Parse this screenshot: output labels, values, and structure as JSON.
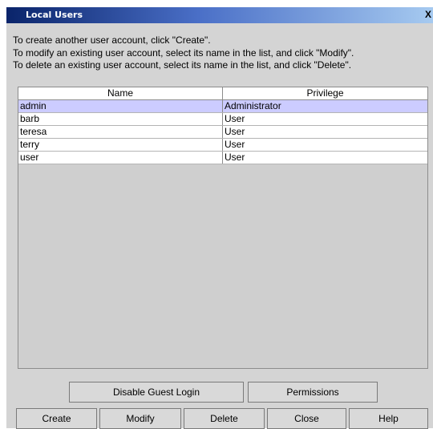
{
  "window": {
    "title": "Local Users",
    "close_glyph": "X"
  },
  "instructions": [
    "To create another user account, click \"Create\".",
    "To modify an existing user account, select its name in the list, and click \"Modify\".",
    "To delete an existing user account, select its name in the list, and click \"Delete\"."
  ],
  "table": {
    "headers": [
      "Name",
      "Privilege"
    ],
    "rows": [
      {
        "name": "admin",
        "privilege": "Administrator",
        "selected": true
      },
      {
        "name": "barb",
        "privilege": "User",
        "selected": false
      },
      {
        "name": "teresa",
        "privilege": "User",
        "selected": false
      },
      {
        "name": "terry",
        "privilege": "User",
        "selected": false
      },
      {
        "name": "user",
        "privilege": "User",
        "selected": false
      }
    ]
  },
  "buttons": {
    "disable_guest": "Disable Guest Login",
    "permissions": "Permissions",
    "create": "Create",
    "modify": "Modify",
    "delete": "Delete",
    "close": "Close",
    "help": "Help"
  }
}
